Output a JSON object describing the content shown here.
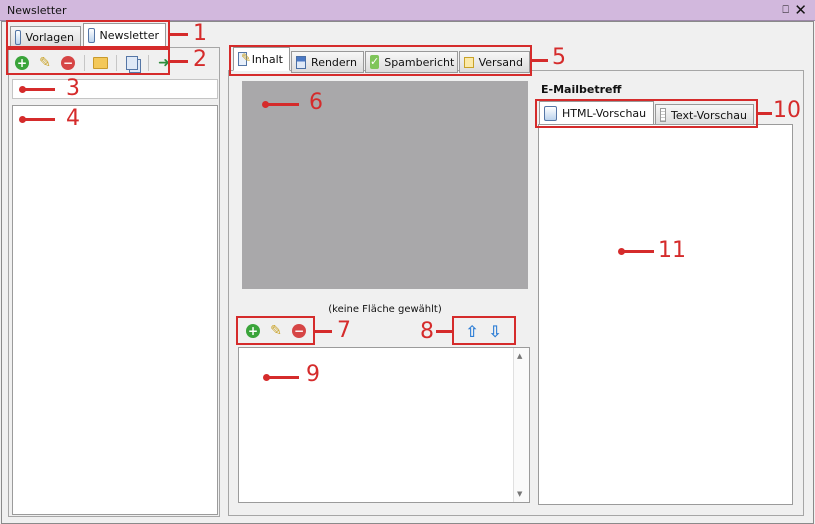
{
  "window": {
    "title": "Newsletter",
    "pin_glyph": "⎕",
    "close_glyph": "✕"
  },
  "left_tabs": [
    {
      "label": "Vorlagen",
      "icon": "template-icon",
      "selected": false
    },
    {
      "label": "Newsletter",
      "icon": "newsletter-icon",
      "selected": true
    }
  ],
  "left_toolbar": {
    "icons": [
      "add-icon",
      "edit-icon",
      "delete-icon",
      "open-folder-icon",
      "copy-icon",
      "send-icon"
    ]
  },
  "main_tabs": [
    {
      "label": "Inhalt",
      "icon": "content-icon",
      "selected": true
    },
    {
      "label": "Rendern",
      "icon": "render-icon",
      "selected": false
    },
    {
      "label": "Spambericht",
      "icon": "spam-report-icon",
      "selected": false
    },
    {
      "label": "Versand",
      "icon": "envelope-icon",
      "selected": false
    }
  ],
  "area_label": "(keine Fläche gewählt)",
  "email_subject_label": "E-Mailbetreff",
  "preview_tabs": [
    {
      "label": "HTML-Vorschau",
      "icon": "html-preview-icon",
      "selected": true
    },
    {
      "label": "Text-Vorschau",
      "icon": "text-preview-icon",
      "selected": false
    }
  ],
  "scroll_up_glyph": "▲",
  "scroll_down_glyph": "▼",
  "callouts": [
    "1",
    "2",
    "3",
    "4",
    "5",
    "6",
    "7",
    "8",
    "9",
    "10",
    "11"
  ],
  "colors": {
    "title_bar": "#d2b8dd",
    "annotation": "#d52b2b",
    "placeholder": "#a9a8aa",
    "accent_blue": "#2f7fd6"
  }
}
